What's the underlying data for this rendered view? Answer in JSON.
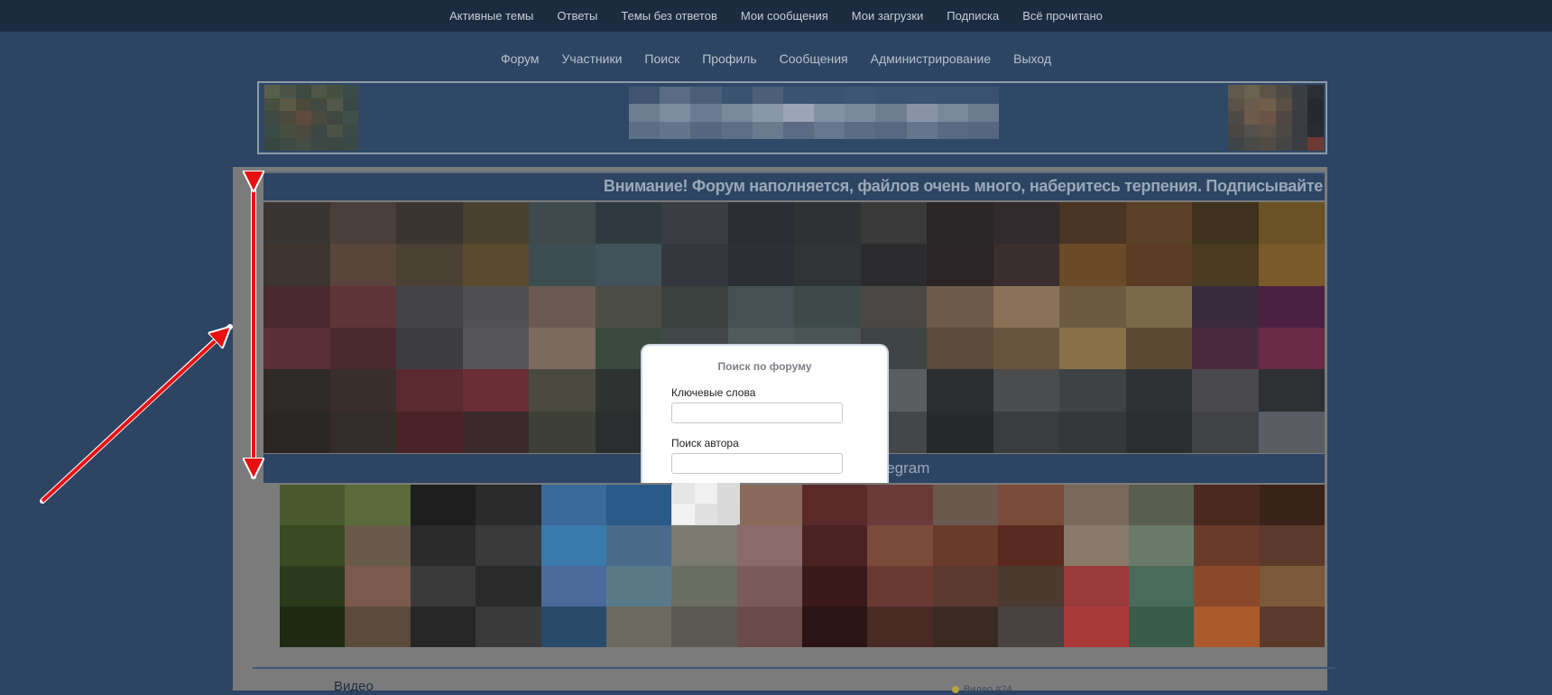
{
  "top_nav": [
    "Активные темы",
    "Ответы",
    "Темы без ответов",
    "Мои сообщения",
    "Мои загрузки",
    "Подписка",
    "Всё прочитано"
  ],
  "main_nav": [
    "Форум",
    "Участники",
    "Поиск",
    "Профиль",
    "Сообщения",
    "Администрирование",
    "Выход"
  ],
  "notice": {
    "text": "Внимание! Форум наполняется, файлов очень много, наберитесь терпения. Подписывайте"
  },
  "strip": {
    "text": "elegram"
  },
  "video": {
    "title": "Видео",
    "link": "Видео #24"
  },
  "search_modal": {
    "title": "Поиск по форуму",
    "keywords_label": "Ключевые слова",
    "keywords_value": "",
    "author_label": "Поиск автора",
    "author_value": ""
  },
  "colors": {
    "background": "#2d4463",
    "topbar": "#1c2c40",
    "arrow": "#e81010"
  }
}
